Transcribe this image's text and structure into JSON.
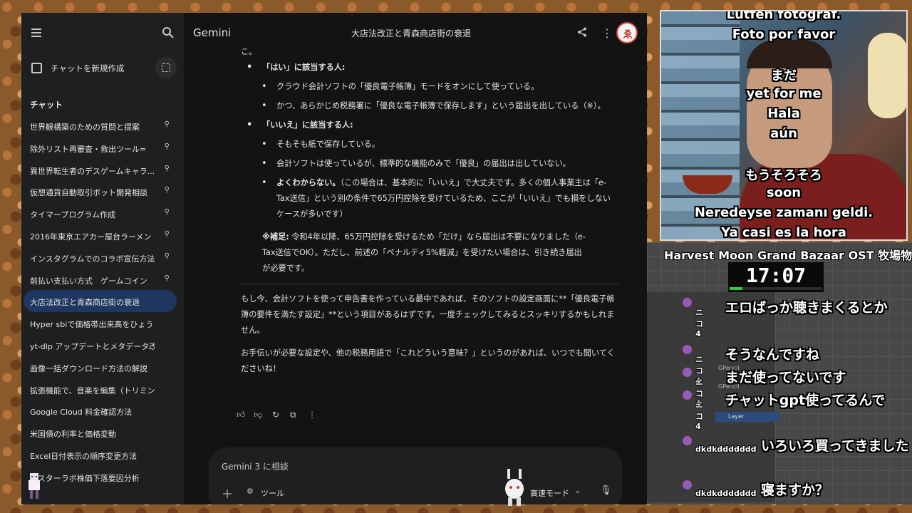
{
  "sidebar": {
    "new_chat_label": "チャットを新規作成",
    "section_title": "チャット",
    "chats": [
      {
        "label": "世界観構築のための質問と提案",
        "pinned": true
      },
      {
        "label": "除外リスト再審査・救出ツール=",
        "pinned": true
      },
      {
        "label": "異世界転生者のデスゲームキャラ...",
        "pinned": true
      },
      {
        "label": "仮想通貨自動取引ボット開発相談",
        "pinned": true
      },
      {
        "label": "タイマープログラム作成",
        "pinned": true
      },
      {
        "label": "2016年東京エアカー屋台ラーメン",
        "pinned": true
      },
      {
        "label": "インスタグラムでのコラボ宣伝方法",
        "pinned": true
      },
      {
        "label": "前払い支払い方式　ゲームコイン",
        "pinned": true
      },
      {
        "label": "大店法改正と青森商店街の衰退",
        "pinned": false,
        "active": true
      },
      {
        "label": "Hyper sbiで価格帯出来高をひょうじす...",
        "pinned": false
      },
      {
        "label": "yt-dlp アップデートとメタデータ改善",
        "pinned": false
      },
      {
        "label": "画像一括ダウンロード方法の解説",
        "pinned": false
      },
      {
        "label": "拡張機能で、音楽を編集（トリミング...",
        "pinned": false
      },
      {
        "label": "Google Cloud 料金確認方法",
        "pinned": false
      },
      {
        "label": "米国債の利率と価格変動",
        "pinned": false
      },
      {
        "label": "Excel日付表示の順序変更方法",
        "pinned": false
      },
      {
        "label": "ンスターラボ株価下落要因分析",
        "pinned": false
      }
    ]
  },
  "header": {
    "brand": "Gemini",
    "title": "大店法改正と青森商店街の衰退"
  },
  "content": {
    "top_fragment": "こ。",
    "yes_heading": "「はい」に該当する人:",
    "yes_items": [
      "クラウド会計ソフトの「優良電子帳簿」モードをオンにして使っている。",
      "かつ、あらかじめ税務署に「優良な電子帳簿で保存します」という届出を出している（※）。"
    ],
    "no_heading": "「いいえ」に該当する人:",
    "no_items": [
      "そもそも紙で保存している。",
      "会計ソフトは使っているが、標準的な機能のみで「優良」の届出は出していない。"
    ],
    "no_unsure_bold": "よくわからない。",
    "no_unsure_rest": "（この場合は、基本的に「いいえ」で大丈夫です。多くの個人事業主は「e-Tax送信」という別の条件で65万円控除を受けているため、ここが「いいえ」でも損をしないケースが多いです）",
    "note_bold": "※補足:",
    "note_rest": " 令和4年以降、65万円控除を受けるため「だけ」なら届出は不要になりました（e-Tax送信でOK）。ただし、前述の「ペナルティ5%軽減」を受けたい場合は、引き続き届出が必要です。",
    "para1": "もし今、会計ソフトを使って申告書を作っている最中であれば、そのソフトの設定画面に**「優良電子帳簿の要件を満たす設定」**という項目があるはずです。一度チェックしてみるとスッキリするかもしれません。",
    "para2": "お手伝いが必要な設定や、他の税務用語で「これどういう意味？」というのがあれば、いつでも聞いてくださいね！"
  },
  "input": {
    "placeholder": "Gemini 3 に相談",
    "tools_label": "ツール",
    "mode_label": "高速モード"
  },
  "stream": {
    "subtitles_top": [
      "Lütfen fotoğraf.",
      "Foto por favor"
    ],
    "subtitles_mid": [
      "まだ",
      "yet for me",
      "Hala",
      "aún"
    ],
    "subtitles_low": [
      "もうそろそろ",
      "soon",
      "Neredeyse zamanı geldi.",
      "Ya casi es la hora"
    ],
    "music_title": "Harvest Moon Grand Bazaar OST 牧場物",
    "clock": "17:07",
    "clock_progress": 0.14,
    "blender_labels": [
      "GPencil",
      "GPencil",
      "Layer"
    ],
    "comments": [
      {
        "user": "ニコ4",
        "text": "エロばっか聴きまくるとか"
      },
      {
        "user": "ニコ4",
        "text": "そうなんですね"
      },
      {
        "user": "ニコ4",
        "text": "まだ使ってないです"
      },
      {
        "user": "ニコ4",
        "text": "チャットgpt使ってるんで"
      },
      {
        "user": "dkdkddddddd",
        "text": "いろいろ買ってきました"
      },
      {
        "user": "dkdkddddddd",
        "text": "寝ますか？"
      }
    ]
  },
  "colors": {
    "app_bg": "#131314",
    "sidebar_bg": "#1e1f20",
    "active_item": "#1f3760",
    "text": "#e3e3e3"
  }
}
